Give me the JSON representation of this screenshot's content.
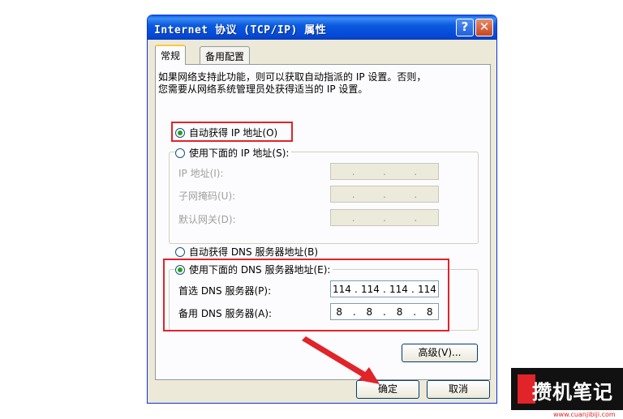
{
  "window": {
    "title": "Internet 协议 (TCP/IP) 属性",
    "help_glyph": "?",
    "close_glyph": "✕"
  },
  "tabs": [
    {
      "label": "常规"
    },
    {
      "label": "备用配置"
    }
  ],
  "intro_line1": "如果网络支持此功能，则可以获取自动指派的 IP 设置。否则，",
  "intro_line2": "您需要从网络系统管理员处获得适当的 IP 设置。",
  "ip_section": {
    "auto_label": "自动获得 IP 地址(O)",
    "manual_label": "使用下面的 IP 地址(S):",
    "fields": [
      {
        "label": "IP 地址(I):",
        "octets": [
          "",
          "",
          "",
          ""
        ]
      },
      {
        "label": "子网掩码(U):",
        "octets": [
          "",
          "",
          "",
          ""
        ]
      },
      {
        "label": "默认网关(D):",
        "octets": [
          "",
          "",
          "",
          ""
        ]
      }
    ]
  },
  "dns_section": {
    "auto_label": "自动获得 DNS 服务器地址(B)",
    "manual_label": "使用下面的 DNS 服务器地址(E):",
    "preferred_label": "首选 DNS 服务器(P):",
    "preferred_octets": [
      "114",
      "114",
      "114",
      "114"
    ],
    "alternate_label": "备用 DNS 服务器(A):",
    "alternate_octets": [
      "8",
      "8",
      "8",
      "8"
    ]
  },
  "buttons": {
    "advanced": "高级(V)...",
    "ok": "确定",
    "cancel": "取消"
  },
  "watermark": {
    "text": "攒机笔记",
    "url": "www.cuanjibiji.com"
  },
  "colors": {
    "highlight": "#e0242a",
    "titlebar": "#0548d6"
  }
}
